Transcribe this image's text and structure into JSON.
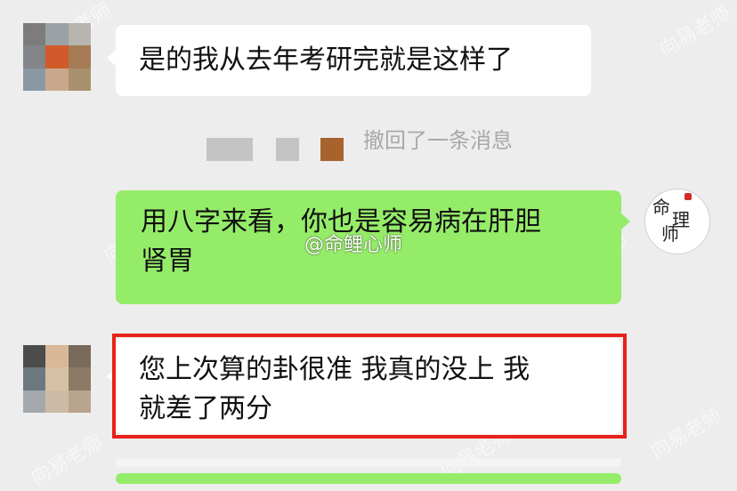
{
  "messages": [
    {
      "side": "left",
      "text": "是的我从去年考研完就是这样了"
    },
    {
      "side": "right",
      "text_line1": "用八字来看，你也是容易病在肝胆",
      "text_line2": "肾胃"
    },
    {
      "side": "left",
      "text_line1": "您上次算的卦很准 我真的没上 我",
      "text_line2": "就差了两分"
    }
  ],
  "recall_notice": "撤回了一条消息",
  "logo": {
    "chars": [
      "命",
      "理",
      "师"
    ]
  },
  "watermarks": {
    "weibo": "@命鲤心师",
    "diagonal": "向易老师"
  },
  "colors": {
    "background": "#ededed",
    "bubble_green": "#95ec69",
    "bubble_white": "#ffffff",
    "highlight_border": "#e8221a",
    "recall_text": "#a9a9a9"
  }
}
